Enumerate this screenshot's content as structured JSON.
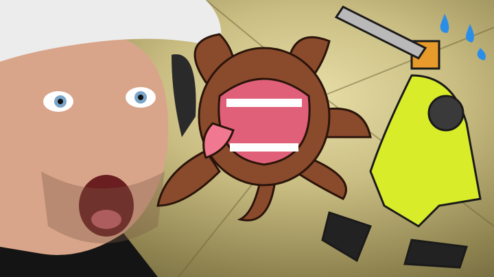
{
  "scene": {
    "colors": {
      "background": "#c9bd82",
      "skin": "#d9a58a",
      "cap": "#ececec",
      "monster": "#8a4a2c",
      "mouth": "#e0607a",
      "hazmat": "#d8ec2a",
      "chainsaw": "#e89a2a",
      "droplet": "#2a8ee8"
    }
  }
}
